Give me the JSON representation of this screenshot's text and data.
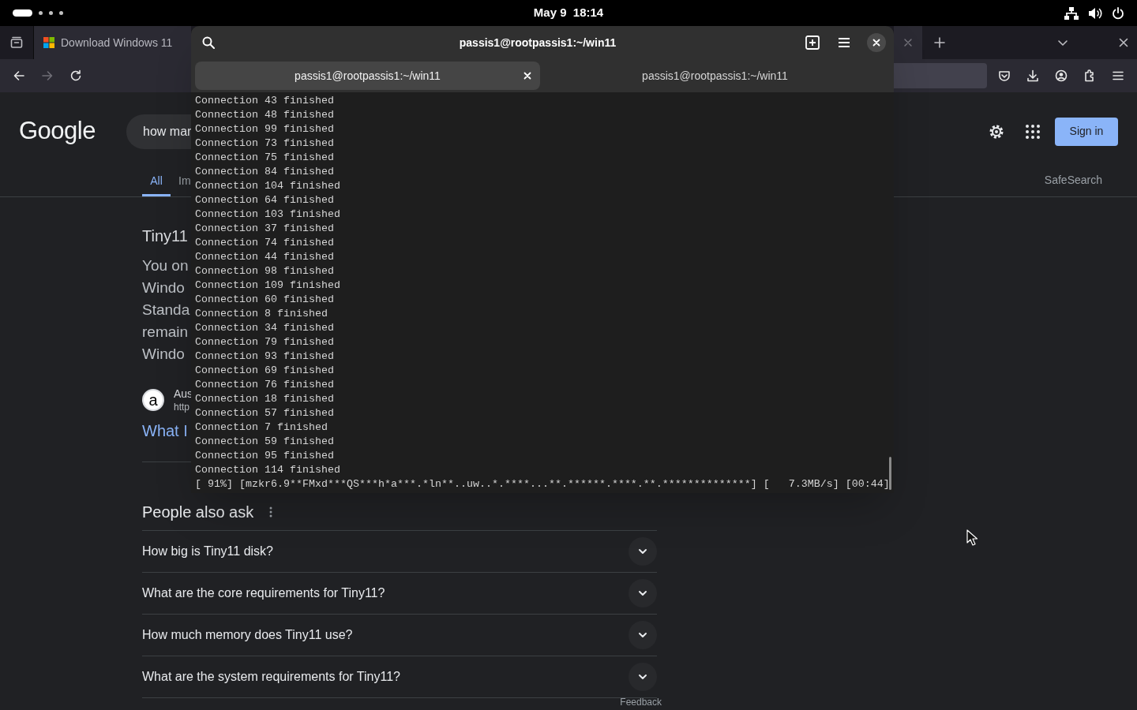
{
  "top_bar": {
    "workspaces": [
      {
        "selected": true
      },
      {
        "selected": false
      },
      {
        "selected": false
      },
      {
        "selected": false
      }
    ],
    "clock": "May 9  18:14"
  },
  "browser": {
    "tabs": [
      {
        "title": "Download Windows 11",
        "selected": true
      }
    ]
  },
  "google": {
    "logo": "Google",
    "search_text": "how mar",
    "sign_in": "Sign in",
    "safesearch": "SafeSearch",
    "tabs": [
      {
        "label": "All",
        "selected": true
      },
      {
        "label": "Im",
        "selected": false
      }
    ],
    "result": {
      "title": "Tiny11",
      "snippet_lines": [
        "You on",
        "Windo",
        "Standa",
        "remain",
        "Windo"
      ],
      "site_letter": "a",
      "site_name": "Aus",
      "site_url": "http",
      "link": "What I"
    },
    "people_also_ask": {
      "heading": "People also ask",
      "questions": [
        "How big is Tiny11 disk?",
        "What are the core requirements for Tiny11?",
        "How much memory does Tiny11 use?",
        "What are the system requirements for Tiny11?"
      ],
      "feedback": "Feedback"
    }
  },
  "terminal": {
    "title": "passis1@rootpassis1:~/win11",
    "tabs": [
      {
        "title": "passis1@rootpassis1:~/win11",
        "selected": true
      },
      {
        "title": "passis1@rootpassis1:~/win11",
        "selected": false
      }
    ],
    "lines": [
      "Connection 43 finished",
      "Connection 48 finished",
      "Connection 99 finished",
      "Connection 73 finished",
      "Connection 75 finished",
      "Connection 84 finished",
      "Connection 104 finished",
      "Connection 64 finished",
      "Connection 103 finished",
      "Connection 37 finished",
      "Connection 74 finished",
      "Connection 44 finished",
      "Connection 98 finished",
      "Connection 109 finished",
      "Connection 60 finished",
      "Connection 8 finished",
      "Connection 34 finished",
      "Connection 79 finished",
      "Connection 93 finished",
      "Connection 69 finished",
      "Connection 76 finished",
      "Connection 18 finished",
      "Connection 57 finished",
      "Connection 7 finished",
      "Connection 59 finished",
      "Connection 95 finished",
      "Connection 114 finished"
    ],
    "progress_line": "[ 91%] [mzkr6.9**FMxd***QS***h*a***.*ln**..uw..*.****...**.******.****.**.**************] [   7.3MB/s] [00:44]"
  }
}
